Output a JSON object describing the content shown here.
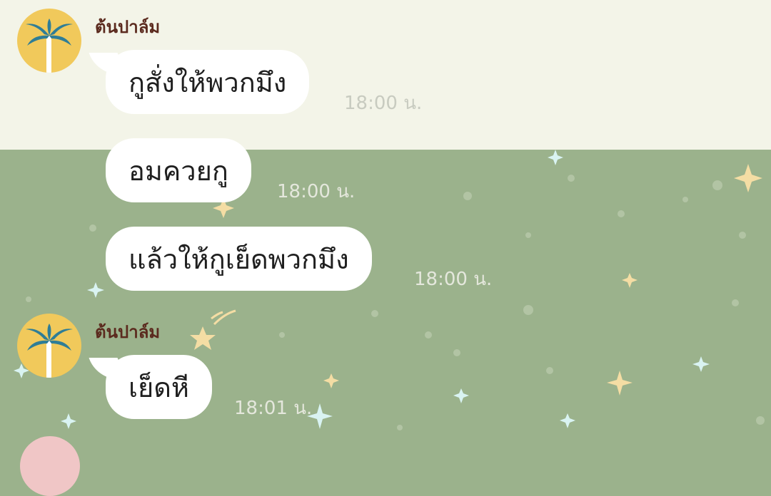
{
  "messages": [
    {
      "sender": "ต้นปาล์ม",
      "text": "กูสั่งให้พวกมึง",
      "time": "18:00 น."
    },
    {
      "text": "อมควยกู",
      "time": "18:00 น."
    },
    {
      "text": "แล้วให้กูเย็ดพวกมึง",
      "time": "18:00 น."
    },
    {
      "sender": "ต้นปาล์ม",
      "text": "เย็ดหี",
      "time": "18:01 น."
    }
  ],
  "avatar_icon": "palm-tree-icon",
  "colors": {
    "chat_background": "#9bb28c",
    "top_band": "#f3f4e8",
    "bubble": "#ffffff",
    "sender_name": "#5b2a1e",
    "avatar": "#f1c95b"
  }
}
